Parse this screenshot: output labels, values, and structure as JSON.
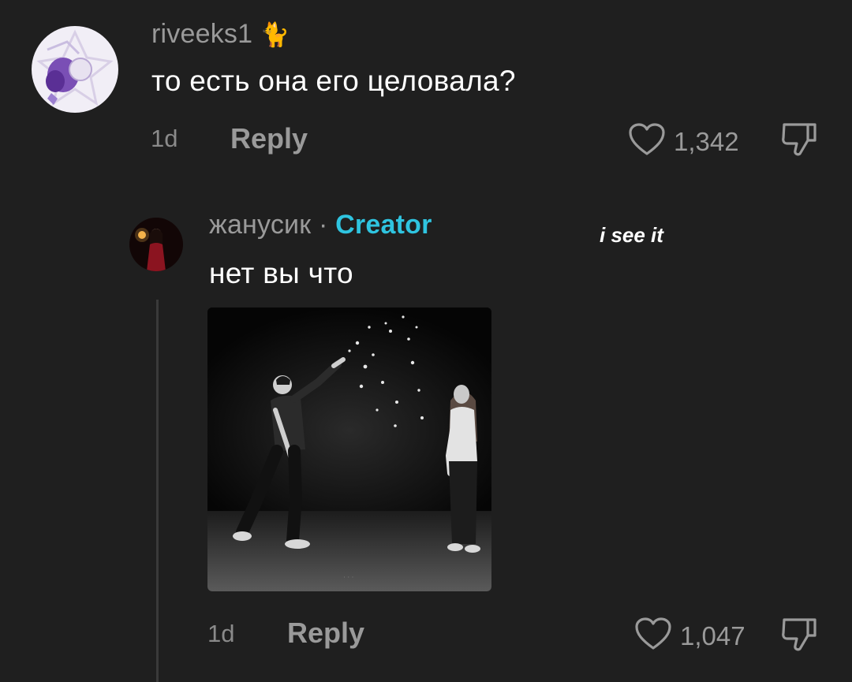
{
  "comment": {
    "username": "riveeks1",
    "text": "то есть она его целовала?",
    "time": "1d",
    "reply_label": "Reply",
    "likes": "1,342"
  },
  "reply": {
    "username": "жанусик",
    "separator": "·",
    "badge": "Creator",
    "text": "нет вы что",
    "time": "1d",
    "reply_label": "Reply",
    "likes": "1,047"
  },
  "overlay_caption": "i see it",
  "colors": {
    "background": "#1f1f1f",
    "creator_badge": "#2fc4e0",
    "muted_text": "#9a9a9a"
  },
  "icons": {
    "like": "heart-outline-icon",
    "dislike": "thumbs-down-outline-icon"
  }
}
